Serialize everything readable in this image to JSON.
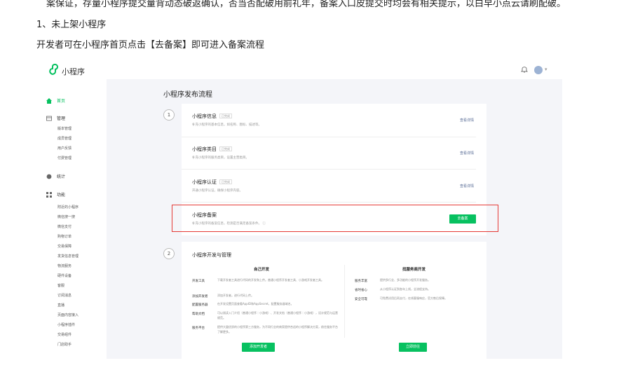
{
  "doc": {
    "top_line": "案保证，存量小程序提交量背动态破返确认，否当否配破用前礼年，备案入口皮提交时均会有相关提示，以白早小点云请刷配破。",
    "heading": "1、未上架小程序",
    "paragraph": "开发者可在小程序首页点击【去备案】即可进入备案流程"
  },
  "screenshot": {
    "app_name": "小程序",
    "sidebar": {
      "home": "首页",
      "groups": [
        {
          "label": "管理",
          "items": [
            "版本管理",
            "成员管理",
            "用户反馈",
            "付费管理"
          ]
        },
        {
          "label": "统计",
          "items": []
        },
        {
          "label": "功能",
          "items": [
            "附近的小程序",
            "微信搜一搜",
            "微信支付",
            "购物订单",
            "交易保障",
            "发货信息管理",
            "物流服务",
            "硬件设备",
            "客服",
            "订阅消息",
            "直播",
            "页面内容接入",
            "小程序插件",
            "交易组件",
            "门店助手"
          ]
        }
      ]
    },
    "page_title": "小程序发布流程",
    "step1": {
      "number": "1",
      "rows": [
        {
          "title": "小程序信息",
          "tag": "已完成",
          "desc": "补充小程序的基本信息，如名称、图标、描述等。",
          "link": "查看详情"
        },
        {
          "title": "小程序类目",
          "tag": "已完成",
          "desc": "补充小程序的服务类目，设置主营类目。",
          "link": "查看详情"
        },
        {
          "title": "小程序认证",
          "tag": "已完成",
          "desc": "开通小程序认证，确保小程序内容。",
          "link": "查看详情"
        },
        {
          "title": "小程序备案",
          "tag": "",
          "desc": "补充小程序的备案信息，检测是否满足备案条件。 ⓘ",
          "button": "去备案"
        }
      ]
    },
    "step2": {
      "number": "2",
      "title": "小程序开发与管理",
      "left": {
        "head": "自己开发",
        "rows": [
          {
            "k": "开发工具",
            "v": "下载开发者工具进行代码的开发和上传。普通小程序开发者工具、小游戏开发者工具。"
          },
          {
            "k": "添加开发者",
            "v": "添加开发者，进行代码上传。"
          },
          {
            "k": "配置服务器",
            "v": "在开发设置页面查看AppID和AppSecret，配置服务器域名。"
          },
          {
            "k": "帮助文档",
            "v": "可以阅读入门介绍（普通小程序｜小游戏）、开发文档（普通小程序｜小游戏），设计规范与运营规范。"
          },
          {
            "k": "服务平台",
            "v": "提供大量优质的小程序第三方服务，为不同行业的商家提供合适的小程序解决方案，前往服务平台了解更多。"
          }
        ],
        "button": "添加开发者"
      },
      "right": {
        "head": "找服务商开发",
        "rows": [
          {
            "k": "服务丰富",
            "v": "提供多行业、多功能的小程序开发服务。"
          },
          {
            "k": "省时省心",
            "v": "从小程序认证到各年上线，全流程支持。"
          },
          {
            "k": "安全可靠",
            "v": "可免费试用后再支付，在线客服响应，官方售后保障。"
          }
        ],
        "button": "立即前往"
      }
    },
    "colors": {
      "accent": "#07c160",
      "highlight": "#e53935",
      "link": "#576b95"
    }
  }
}
